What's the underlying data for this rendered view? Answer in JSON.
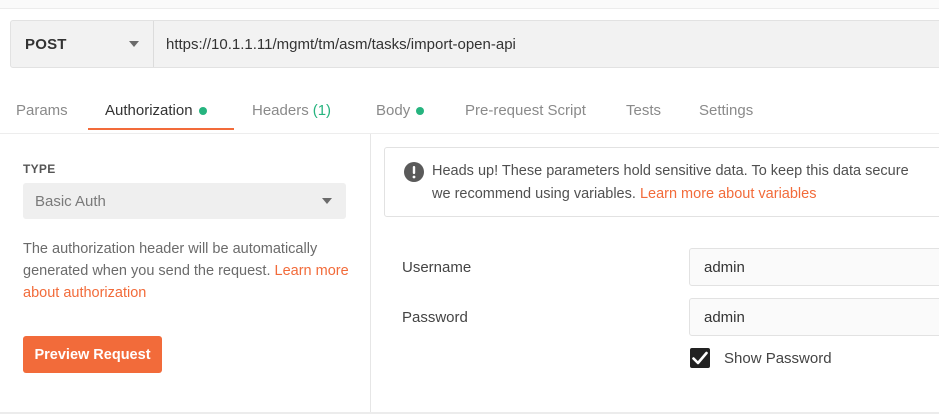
{
  "request": {
    "method": "POST",
    "url": "https://10.1.1.11/mgmt/tm/asm/tasks/import-open-api"
  },
  "tabs": [
    {
      "label": "Params"
    },
    {
      "label": "Authorization"
    },
    {
      "label": "Headers",
      "count": "(1)"
    },
    {
      "label": "Body"
    },
    {
      "label": "Pre-request Script"
    },
    {
      "label": "Tests"
    },
    {
      "label": "Settings"
    }
  ],
  "active_tab": "Authorization",
  "auth": {
    "type_label": "TYPE",
    "type_value": "Basic Auth",
    "help_text": "The authorization header will be automatically generated when you send the request.",
    "help_link": "Learn more about authorization",
    "preview_button": "Preview Request"
  },
  "notice": {
    "line1": "Heads up! These parameters hold sensitive data. To keep this data secure",
    "line2": "we recommend using variables.",
    "link": "Learn more about variables"
  },
  "fields": {
    "username_label": "Username",
    "username_value": "admin",
    "password_label": "Password",
    "password_value": "admin",
    "show_password_label": "Show Password",
    "show_password_checked": true
  },
  "colors": {
    "accent": "#f26b3a",
    "status_green": "#26b47f"
  }
}
